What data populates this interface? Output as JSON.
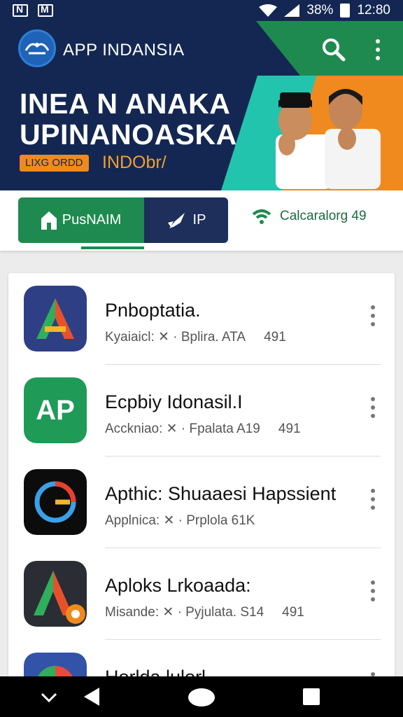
{
  "status_bar": {
    "battery": "38%",
    "time": "12:80",
    "icons": [
      "notification-n-icon",
      "gmail-icon",
      "wifi-icon",
      "signal-icon",
      "battery-icon"
    ]
  },
  "app_bar": {
    "title": "APP INDANSIA",
    "icons": [
      "search-icon",
      "more-vert-icon"
    ]
  },
  "banner": {
    "headline_line1": "INEA N ANAKA",
    "headline_line2": "UPINANOASKA",
    "tag": "LIXG ORDD",
    "tag_text": "INDObr/"
  },
  "tabs": [
    {
      "label": "PusNAIM",
      "icon": "house-icon",
      "active": true
    },
    {
      "label": "IP",
      "icon": "rocket-icon",
      "active": false
    },
    {
      "label": "Calcaralorg 49",
      "icon": "wifi-icon",
      "active": false
    }
  ],
  "apps": [
    {
      "title": "Pnboptatia.",
      "meta_left": "Kyaiaicl: ✕ · Bplira. ATA",
      "meta_right": "491"
    },
    {
      "title": "Ecpbiy Idonasil.I",
      "meta_left": "Acckniao: ✕ · Fpalata A19",
      "meta_right": "491"
    },
    {
      "title": "Apthic: Shuaaesi Hapssient",
      "meta_left": "Applnica: ✕ · Prplola 61K",
      "meta_right": ""
    },
    {
      "title": "Aploks Lrkoaada:",
      "meta_left": "Misande: ✕ · Pyjulata. S14",
      "meta_right": "491"
    },
    {
      "title": "Horlda lulorl",
      "meta_left": "",
      "meta_right": ""
    }
  ],
  "colors": {
    "navy": "#142752",
    "green": "#1f8a4f",
    "teal": "#23c4ae",
    "orange": "#f08a1e"
  }
}
